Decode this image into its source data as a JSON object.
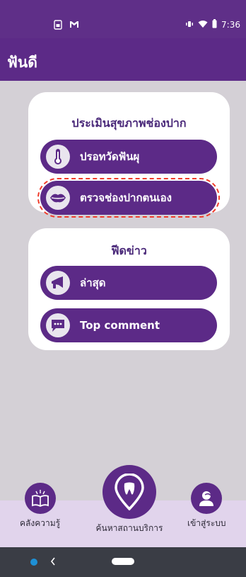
{
  "status_bar": {
    "left_icons": [
      "sim-icon",
      "mail-icon"
    ],
    "time": "7:36",
    "right_icons": [
      "vibrate-icon",
      "wifi-icon",
      "battery-icon"
    ]
  },
  "app_bar": {
    "title": "ฟันดี"
  },
  "sections": {
    "assessment": {
      "title": "ประเมินสุขภาพช่องปาก",
      "buttons": [
        {
          "label": "ปรอทวัดฟันผุ",
          "icon": "thermometer-icon"
        },
        {
          "label": "ตรวจช่องปากตนเอง",
          "icon": "lips-icon"
        }
      ]
    },
    "news": {
      "title": "ฟีดข่าว",
      "buttons": [
        {
          "label": "ล่าสุด",
          "icon": "megaphone-icon"
        },
        {
          "label": "Top comment",
          "icon": "chat-icon"
        }
      ]
    }
  },
  "bottom_nav": {
    "items": [
      {
        "label": "คลังความรู้",
        "icon": "book-icon"
      },
      {
        "label": "ค้นหาสถานบริการ",
        "icon": "tooth-pin-icon"
      },
      {
        "label": "เข้าสู่ระบบ",
        "icon": "user-icon"
      }
    ]
  },
  "colors": {
    "primary": "#5c2a87",
    "status_bar": "#5f2f88",
    "background": "#d4d0d6",
    "bottom_nav_bg": "#e1d4ec",
    "highlight": "#f03c2b"
  }
}
